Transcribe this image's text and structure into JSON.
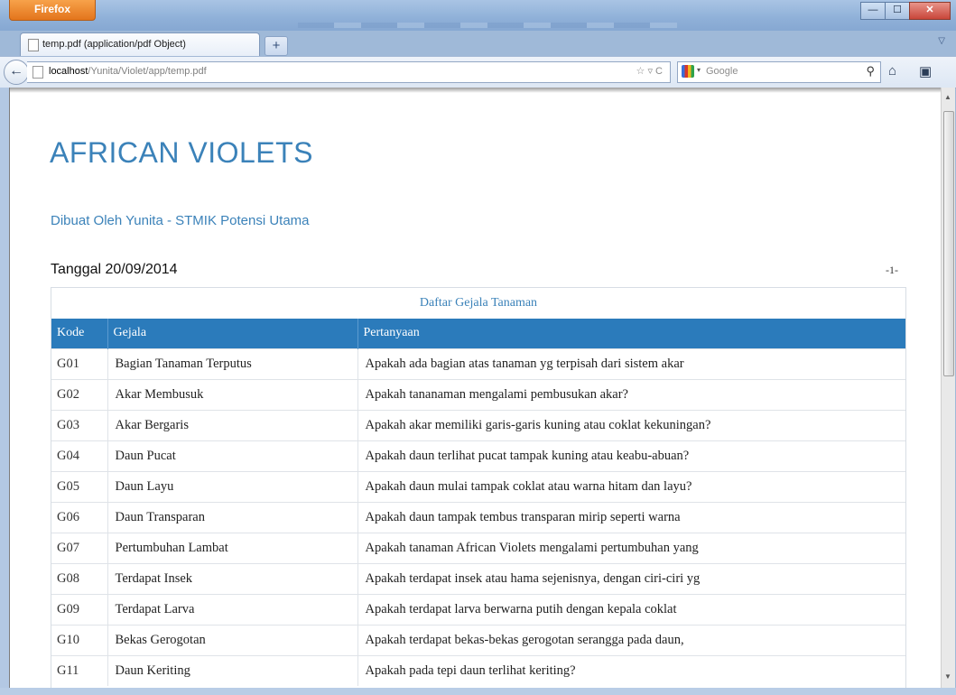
{
  "browser": {
    "menu_button": "Firefox",
    "tab_title": "temp.pdf (application/pdf Object)",
    "new_tab": "+",
    "url_host": "localhost",
    "url_path": "/Yunita/Violet/app/temp.pdf",
    "search_placeholder": "Google",
    "window_controls": {
      "minimize": "—",
      "maximize": "☐",
      "close": "✕"
    }
  },
  "document": {
    "title": "AFRICAN VIOLETS",
    "subtitle": "Dibuat Oleh Yunita - STMIK Potensi Utama",
    "date_label": "Tanggal 20/09/2014",
    "page_number": "-1-",
    "table": {
      "caption": "Daftar Gejala Tanaman",
      "headers": [
        "Kode",
        "Gejala",
        "Pertanyaan"
      ],
      "rows": [
        [
          "G01",
          "Bagian Tanaman Terputus",
          "Apakah ada bagian atas tanaman yg terpisah dari sistem akar"
        ],
        [
          "G02",
          "Akar Membusuk",
          "Apakah tananaman mengalami pembusukan akar?"
        ],
        [
          "G03",
          "Akar Bergaris",
          "Apakah akar memiliki garis-garis kuning atau coklat kekuningan?"
        ],
        [
          "G04",
          "Daun Pucat",
          "Apakah daun terlihat pucat  tampak kuning atau keabu-abuan?"
        ],
        [
          "G05",
          "Daun Layu",
          "Apakah daun mulai tampak coklat atau warna hitam dan layu?"
        ],
        [
          "G06",
          "Daun Transparan",
          "Apakah daun tampak tembus transparan mirip seperti warna"
        ],
        [
          "G07",
          "Pertumbuhan Lambat",
          "Apakah tanaman African Violets mengalami pertumbuhan yang"
        ],
        [
          "G08",
          "Terdapat Insek",
          "Apakah terdapat insek atau hama sejenisnya, dengan ciri-ciri yg"
        ],
        [
          "G09",
          "Terdapat Larva",
          "Apakah terdapat larva berwarna putih dengan kepala coklat"
        ],
        [
          "G10",
          "Bekas Gerogotan",
          "Apakah terdapat bekas-bekas gerogotan serangga pada daun,"
        ],
        [
          "G11",
          "Daun Keriting",
          "Apakah pada tepi daun terlihat keriting?"
        ]
      ]
    }
  }
}
